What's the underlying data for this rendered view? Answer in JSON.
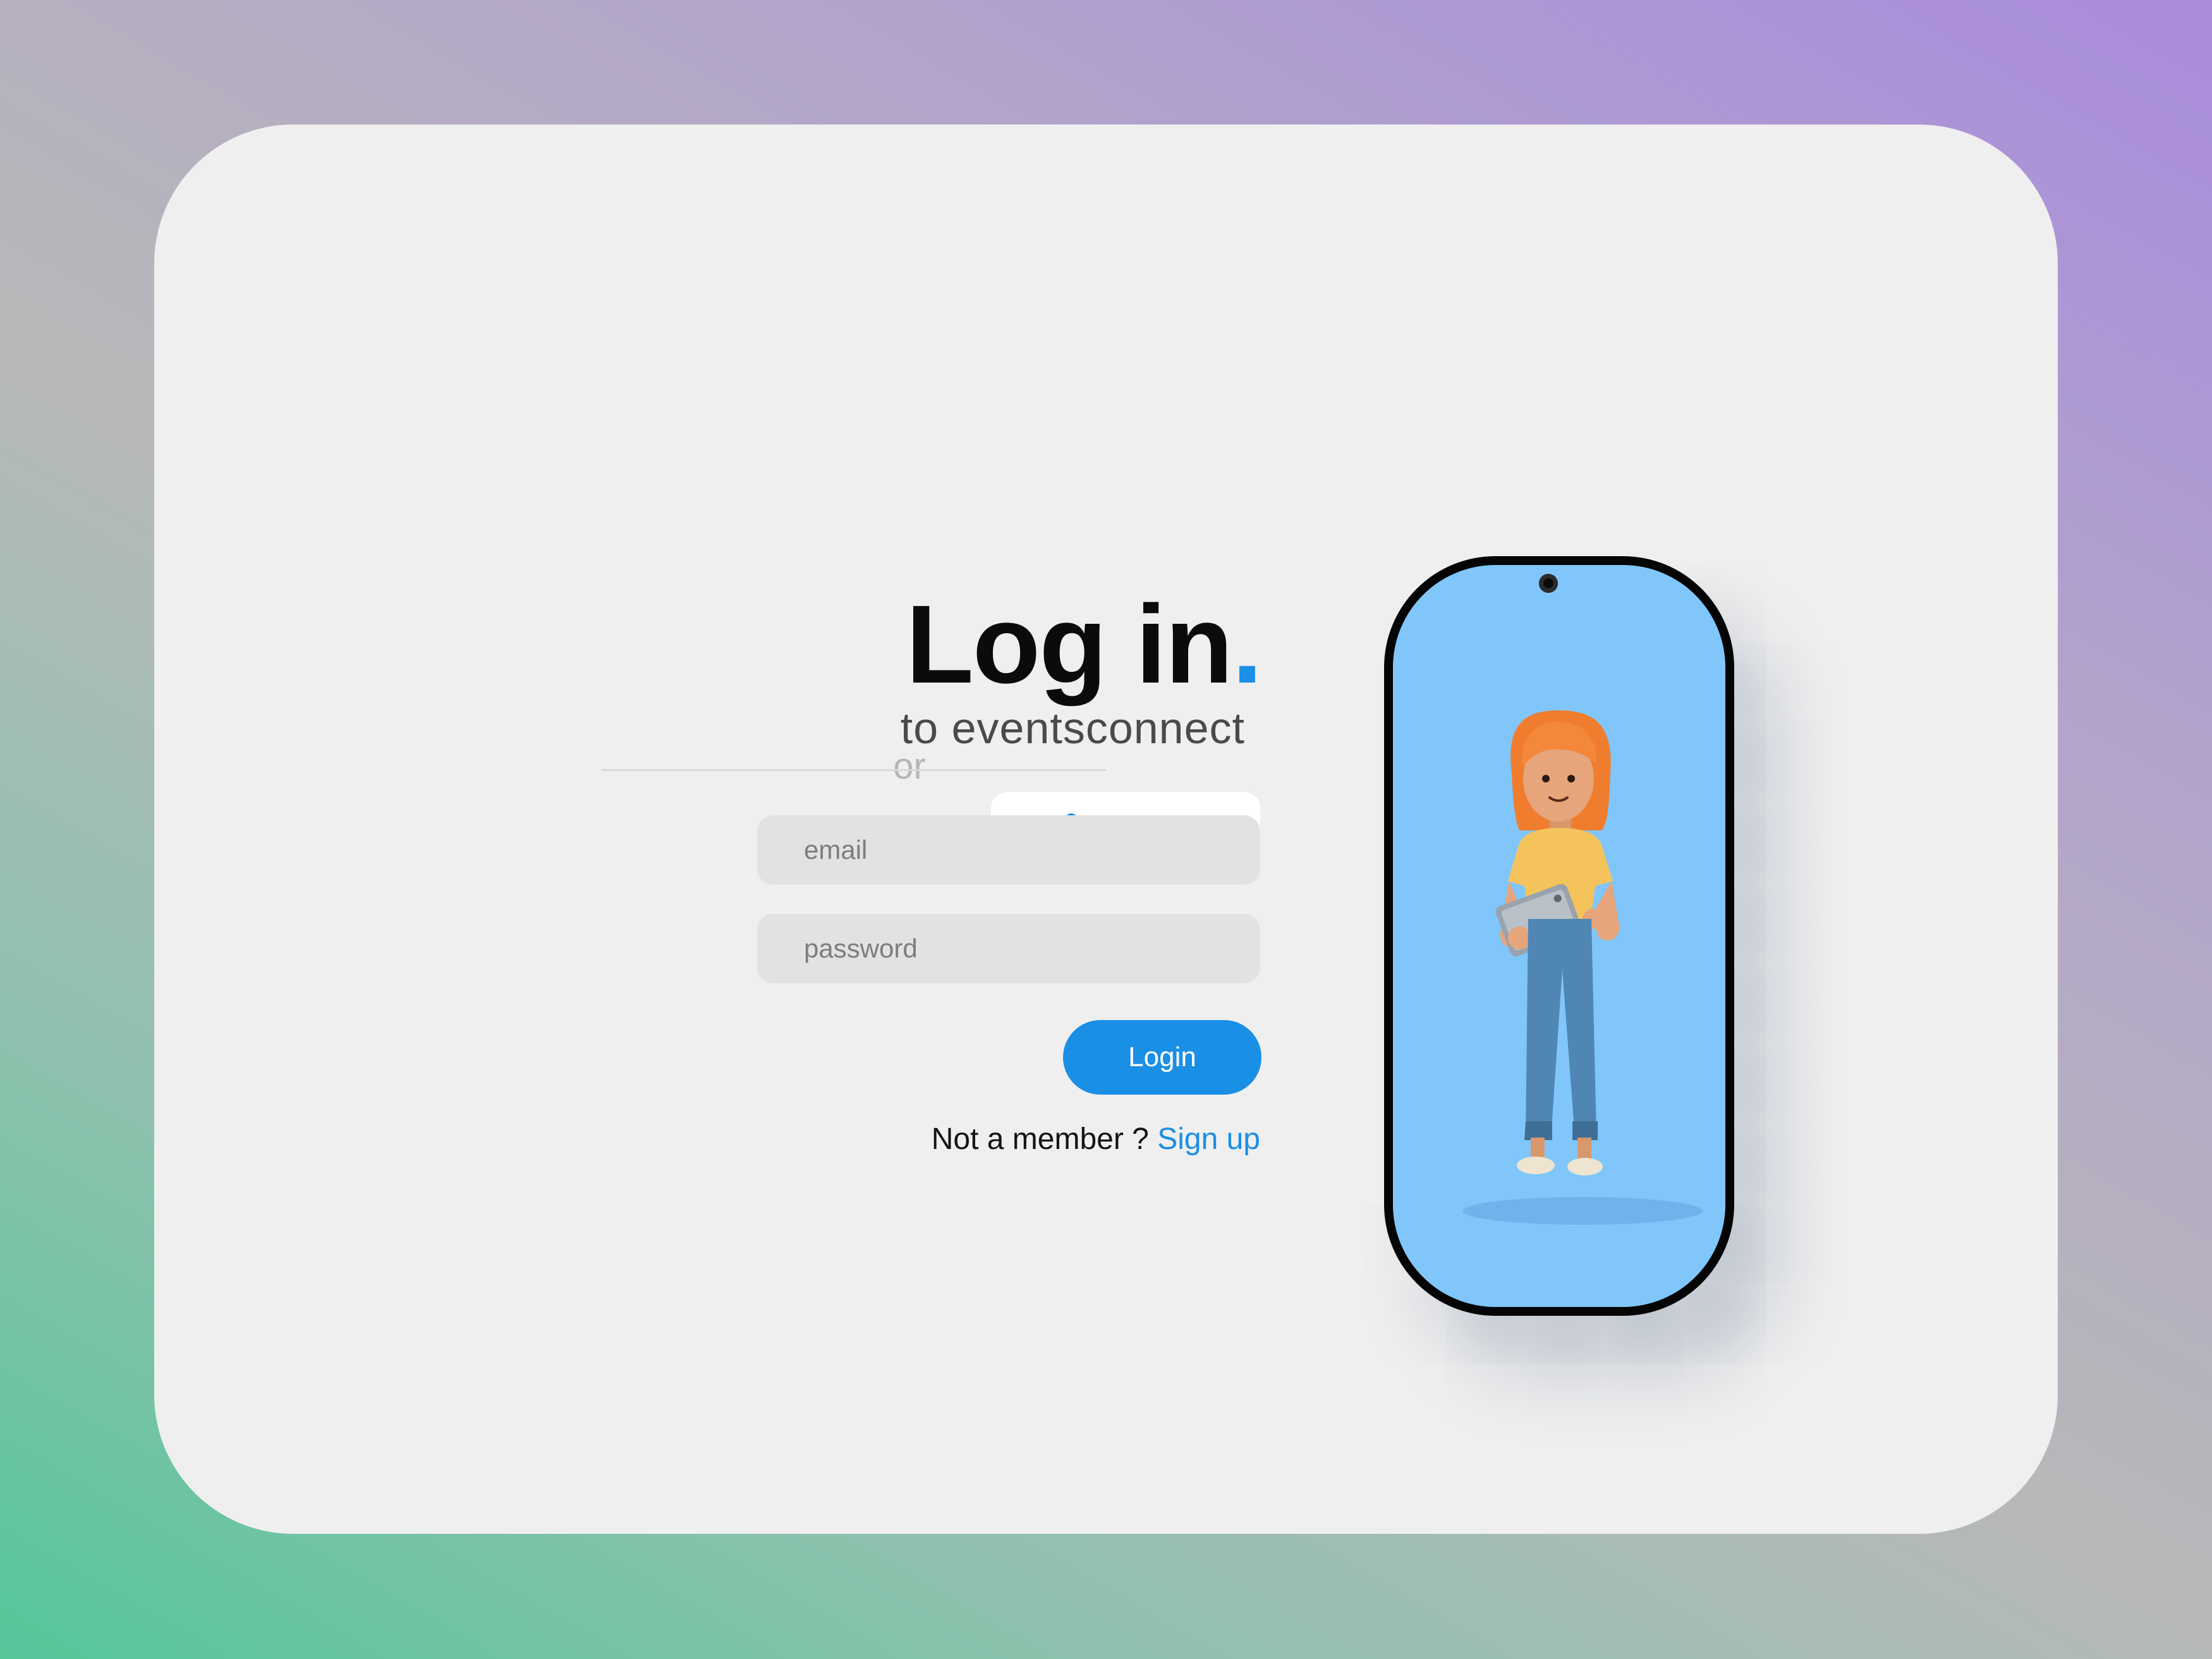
{
  "login": {
    "title": "Log in",
    "title_dot": ".",
    "subtitle": "to eventsconnect",
    "admin_button_label": "admin",
    "divider_text": "or",
    "email_placeholder": "email",
    "password_placeholder": "password",
    "login_button_label": "Login",
    "signup_prompt": "Not a member ?",
    "signup_link": "Sign up"
  },
  "icons": {
    "admin": "user-check-icon",
    "phone_camera": "camera-icon"
  },
  "colors": {
    "accent": "#1a8fe6",
    "card_background": "#efefef",
    "phone_screen": "#80c6fb"
  }
}
